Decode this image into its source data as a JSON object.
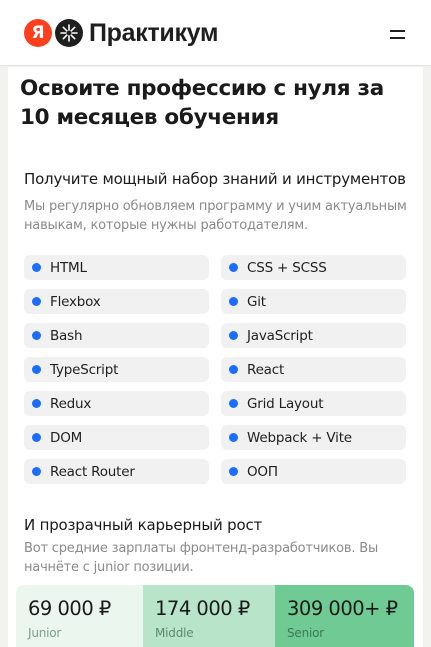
{
  "header": {
    "logo_ya": "Я",
    "logo_text": "Практикум",
    "menu_icon": "hamburger-icon"
  },
  "page": {
    "title": "Освоите профессию с нуля за 10 месяцев обучения"
  },
  "skills": {
    "title": "Получите мощный набор знаний и инструментов",
    "description": "Мы регулярно обновляем программу и учим актуальным навыкам, которые нужны работодателям.",
    "bullet_color": "#1a6dff",
    "items": [
      "HTML",
      "CSS + SCSS",
      "Flexbox",
      "Git",
      "Bash",
      "JavaScript",
      "TypeScript",
      "React",
      "Redux",
      "Grid Layout",
      "DOM",
      "Webpack + Vite",
      "React Router",
      "ООП"
    ]
  },
  "career": {
    "title": "И прозрачный карьерный рост",
    "description": "Вот средние зарплаты фронтенд-разработчиков. Вы начнёте с junior позиции.",
    "levels": [
      {
        "value": "69 000 ₽",
        "label": "Junior",
        "bg": "#eaf6ee",
        "label_color": "#7fa08a"
      },
      {
        "value": "174 000 ₽",
        "label": "Middle",
        "bg": "#b8e5c9",
        "label_color": "#5d8a6d"
      },
      {
        "value": "309 000+ ₽",
        "label": "Senior",
        "bg": "#6fcb93",
        "label_color": "#3e7a55"
      }
    ]
  }
}
